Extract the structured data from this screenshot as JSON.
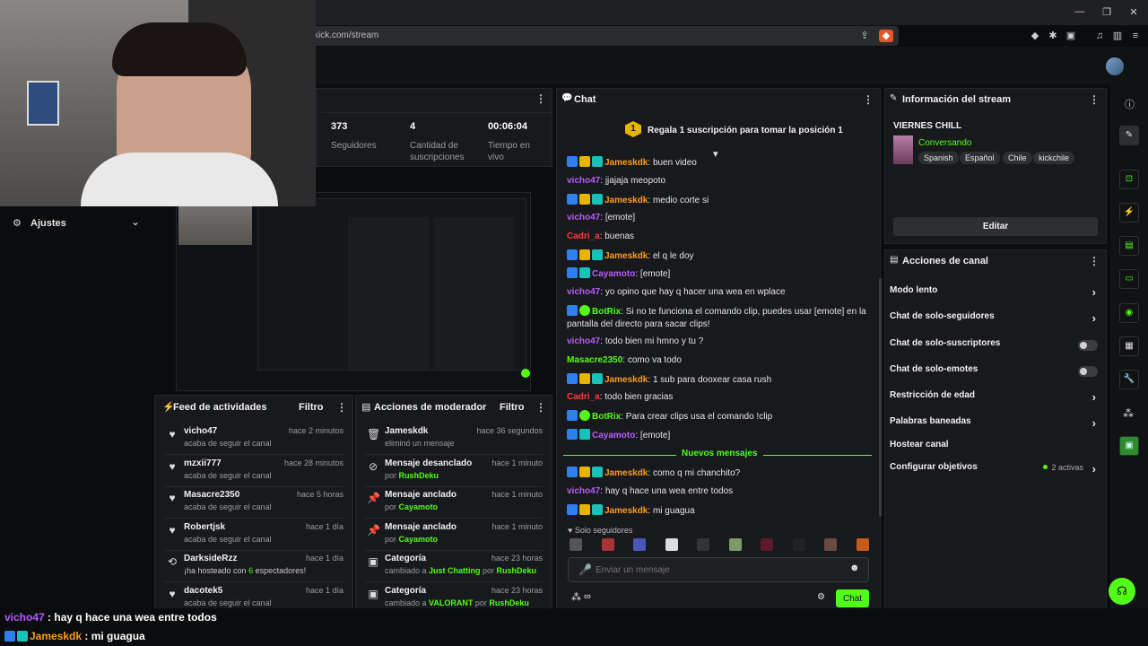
{
  "browser": {
    "url": "kick.com/stream",
    "window_controls": [
      "minimize-icon",
      "restore-icon",
      "close-icon"
    ]
  },
  "sidebar": {
    "settings_label": "Ajustes"
  },
  "stats": [
    {
      "value": "373",
      "label": "Seguidores"
    },
    {
      "value": "4",
      "label": "Cantidad de suscripciones"
    },
    {
      "value": "00:06:04",
      "label": "Tiempo en vivo"
    }
  ],
  "activity_feed": {
    "title": "Feed de actividades",
    "filter": "Filtro",
    "items": [
      {
        "name": "vicho47",
        "text": "acaba de seguir el canal",
        "time": "hace 2 minutos",
        "icon": "heart-icon"
      },
      {
        "name": "mzxii777",
        "text": "acaba de seguir el canal",
        "time": "hace 28 minutos",
        "icon": "heart-icon"
      },
      {
        "name": "Masacre2350",
        "text": "acaba de seguir el canal",
        "time": "hace 5 horas",
        "icon": "heart-icon"
      },
      {
        "name": "Robertjsk",
        "text": "acaba de seguir el canal",
        "time": "hace 1 día",
        "icon": "heart-icon"
      },
      {
        "name": "DarksideRzz",
        "text_pre": "¡ha hosteado con ",
        "count": "6",
        "text_post": " espectadores!",
        "time": "hace 1 día",
        "icon": "host-icon"
      },
      {
        "name": "dacotek5",
        "text": "acaba de seguir el canal",
        "time": "hace 1 día",
        "icon": "heart-icon"
      }
    ]
  },
  "mod_actions": {
    "title": "Acciones de moderador",
    "filter": "Filtro",
    "items": [
      {
        "title": "Jameskdk",
        "sub": "eliminó un mensaje",
        "time": "hace 36 segundos",
        "icon": "trash-icon"
      },
      {
        "title": "Mensaje desanclado",
        "sub_pre": "por ",
        "sub_user": "RushDeku",
        "time": "hace 1 minuto",
        "icon": "unpin-icon"
      },
      {
        "title": "Mensaje anclado",
        "sub_pre": "por ",
        "sub_user": "Cayamoto",
        "time": "hace 1 minuto",
        "icon": "pin-icon"
      },
      {
        "title": "Mensaje anclado",
        "sub_pre": "por ",
        "sub_user": "Cayamoto",
        "time": "hace 1 minuto",
        "icon": "pin-icon"
      },
      {
        "title": "Categoría",
        "sub_pre": "cambiado a ",
        "sub_cat": "Just Chatting",
        "sub_mid": " por ",
        "sub_user": "RushDeku",
        "time": "hace 23 horas",
        "icon": "category-icon"
      },
      {
        "title": "Categoría",
        "sub_pre": "cambiado a ",
        "sub_cat": "VALORANT",
        "sub_mid": " por ",
        "sub_user": "RushDeku",
        "time": "hace 23 horas",
        "icon": "category-icon"
      }
    ]
  },
  "chat": {
    "title": "Chat",
    "sub_goal": "Regala 1 suscripción para tomar la posición 1",
    "sub_goal_rank": "1",
    "new_messages": "Nuevos mensajes",
    "followers_only": "Solo seguidores",
    "input_placeholder": "Enviar un mensaje",
    "send_label": "Chat",
    "messages": [
      {
        "user": "Jameskdk",
        "color": "u-orange",
        "badges": [
          "b-mod",
          "b-crown",
          "b-vip"
        ],
        "text": "buen video"
      },
      {
        "user": "vicho47",
        "color": "u-purple",
        "badges": [],
        "text": "jjajaja meopoto"
      },
      {
        "user": "Jameskdk",
        "color": "u-orange",
        "badges": [
          "b-mod",
          "b-crown",
          "b-vip"
        ],
        "text": "medio corte si"
      },
      {
        "user": "vicho47",
        "color": "u-purple",
        "badges": [],
        "text": "[emote]"
      },
      {
        "user": "Cadri_a",
        "color": "u-red",
        "badges": [],
        "text": "buenas"
      },
      {
        "user": "Jameskdk",
        "color": "u-orange",
        "badges": [
          "b-mod",
          "b-crown",
          "b-vip"
        ],
        "text": "el q le doy"
      },
      {
        "user": "Cayamoto",
        "color": "u-purple",
        "badges": [
          "b-mod",
          "b-vip"
        ],
        "text": "[emote]"
      },
      {
        "user": "vicho47",
        "color": "u-purple",
        "badges": [],
        "text": "yo opino que hay q hacer una wea en wplace"
      },
      {
        "user": "BotRix",
        "color": "u-green",
        "badges": [
          "b-mod",
          "b-bot"
        ],
        "text": "Si no te funciona el comando clip, puedes usar [emote] en la pantalla del directo para sacar clips!"
      },
      {
        "user": "vicho47",
        "color": "u-purple",
        "badges": [],
        "text": "todo bien mi hmno y tu ?"
      },
      {
        "user": "Masacre2350",
        "color": "u-green",
        "badges": [],
        "text": "como va todo"
      },
      {
        "user": "Jameskdk",
        "color": "u-orange",
        "badges": [
          "b-mod",
          "b-crown",
          "b-vip"
        ],
        "text": "1 sub para dooxear casa rush"
      },
      {
        "user": "Cadri_a",
        "color": "u-red",
        "badges": [],
        "text": "todo bien gracias"
      },
      {
        "user": "BotRix",
        "color": "u-green",
        "badges": [
          "b-mod",
          "b-bot"
        ],
        "text": "Para crear clips usa el comando !clip"
      },
      {
        "user": "Cayamoto",
        "color": "u-purple",
        "badges": [
          "b-mod",
          "b-vip"
        ],
        "text": "[emote]"
      }
    ],
    "new_block": [
      {
        "user": "Jameskdk",
        "color": "u-orange",
        "badges": [
          "b-mod",
          "b-crown",
          "b-vip"
        ],
        "text": "como q mi chanchito?"
      },
      {
        "user": "vicho47",
        "color": "u-purple",
        "badges": [],
        "text": "hay q hace una wea entre todos"
      },
      {
        "user": "Jameskdk",
        "color": "u-orange",
        "badges": [
          "b-mod",
          "b-crown",
          "b-vip"
        ],
        "text": "mi guagua"
      }
    ]
  },
  "stream_info": {
    "title": "Información del stream",
    "stream_title": "VIERNES CHILL",
    "category": "Conversando",
    "tags": [
      "Spanish",
      "Español",
      "Chile",
      "kickchile"
    ],
    "edit_label": "Editar"
  },
  "channel_actions": {
    "title": "Acciones de canal",
    "items": [
      {
        "label": "Modo lento",
        "control": "chevron"
      },
      {
        "label": "Chat de solo-seguidores",
        "control": "chevron"
      },
      {
        "label": "Chat de solo-suscriptores",
        "control": "toggle"
      },
      {
        "label": "Chat de solo-emotes",
        "control": "toggle"
      },
      {
        "label": "Restricción de edad",
        "control": "chevron"
      },
      {
        "label": "Palabras baneadas",
        "control": "chevron"
      },
      {
        "label": "Hostear canal",
        "control": "none"
      },
      {
        "label": "Configurar objetivos",
        "control": "chevron",
        "status": "2 activas"
      }
    ]
  },
  "overlay": [
    {
      "user": "vicho47",
      "text": " : hay q hace una wea entre todos"
    },
    {
      "user": "Jameskdk",
      "text": " : mi guagua"
    }
  ],
  "colors": {
    "accent": "#53fc18",
    "panel": "#18191c",
    "background": "#0b0c0e"
  }
}
